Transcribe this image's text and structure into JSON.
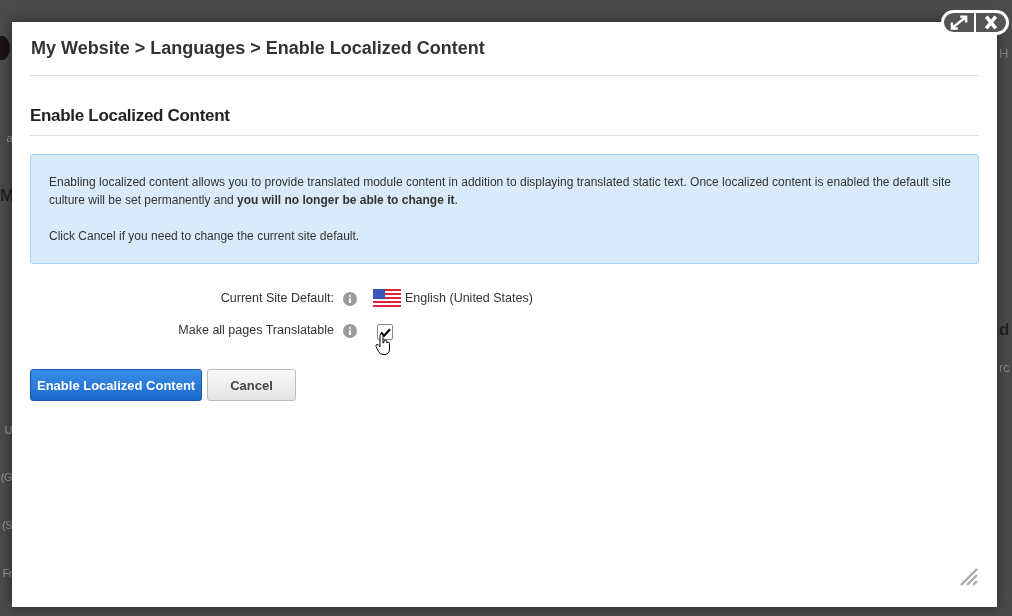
{
  "background": {
    "left_fragments": [
      "a",
      "M",
      "U",
      "(G",
      "(S",
      "Fr"
    ],
    "right_fragments": [
      "H",
      "d",
      "rc"
    ]
  },
  "dialog": {
    "breadcrumb": "My Website > Languages > Enable Localized Content",
    "heading": "Enable Localized Content",
    "notice": [
      "Enabling localized content allows you to provide translated module content in addition to displaying translated static text. Once localized content is enabled the default site culture will be set permanently and **you will no longer be able to change it**.",
      "Click Cancel if you need to change the current site default."
    ],
    "fields": [
      {
        "kind": "language",
        "label": "Current Site Default:",
        "value": "English (United States)"
      },
      {
        "kind": "checkbox",
        "label": "Make all pages Translatable",
        "checked": true
      }
    ],
    "buttons": [
      {
        "label": "Enable Localized Content",
        "primary": true
      },
      {
        "label": "Cancel",
        "primary": false
      }
    ]
  }
}
